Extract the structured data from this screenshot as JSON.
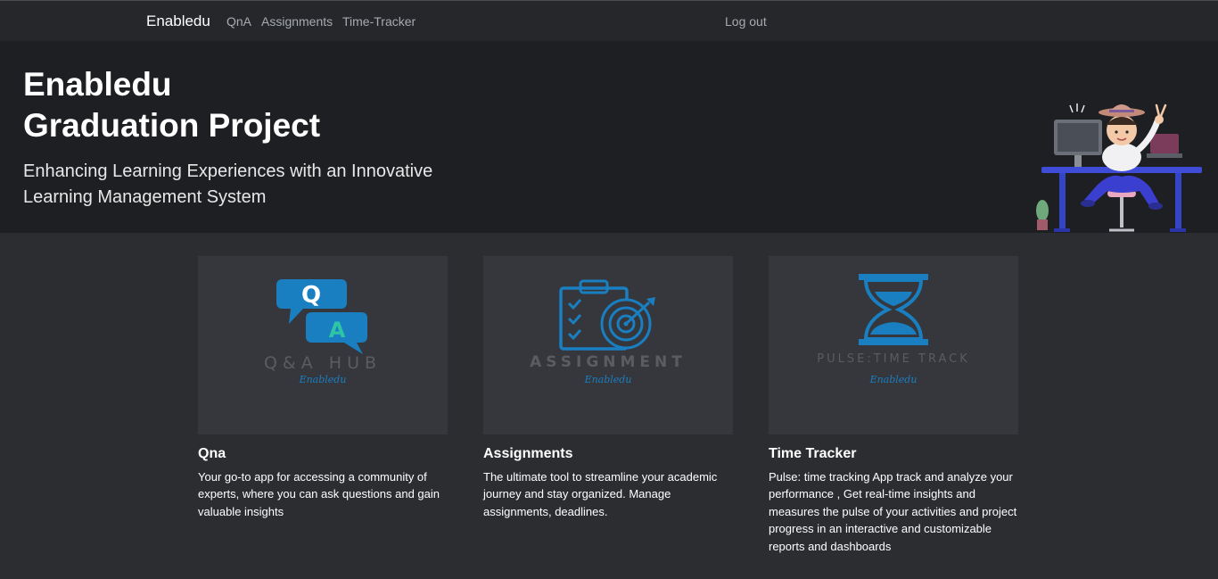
{
  "nav": {
    "brand": "Enabledu",
    "links": [
      "QnA",
      "Assignments",
      "Time-Tracker"
    ],
    "logout": "Log out"
  },
  "hero": {
    "title_line1": "Enabledu",
    "title_line2": "Graduation Project",
    "subtitle": "Enhancing Learning Experiences with an Innovative Learning Management System"
  },
  "cards": [
    {
      "logo_text": "Q&A HUB",
      "logo_sub": "Enabledu",
      "title": "Qna",
      "text": "Your go-to app for accessing a community of experts, where you can ask questions and gain valuable insights"
    },
    {
      "logo_text": "ASSIGNMENT",
      "logo_sub": "Enabledu",
      "title": "Assignments",
      "text": "The ultimate tool to streamline your academic journey and stay organized. Manage assignments, deadlines."
    },
    {
      "logo_text": "PULSE:TIME TRACK",
      "logo_sub": "Enabledu",
      "title": "Time Tracker",
      "text": "Pulse: time tracking App track and analyze your performance , Get real-time insights and measures the pulse of your activities and project progress in an interactive and customizable reports and dashboards"
    }
  ],
  "colors": {
    "page_bg": "#2b2d31",
    "navbar_bg": "#25272b",
    "hero_bg": "#1e1f22",
    "card_bg": "#35373c",
    "logo_blue": "#1a7fc1",
    "logo_teal": "#2ec4a6",
    "logo_gray": "#5a5c62"
  }
}
